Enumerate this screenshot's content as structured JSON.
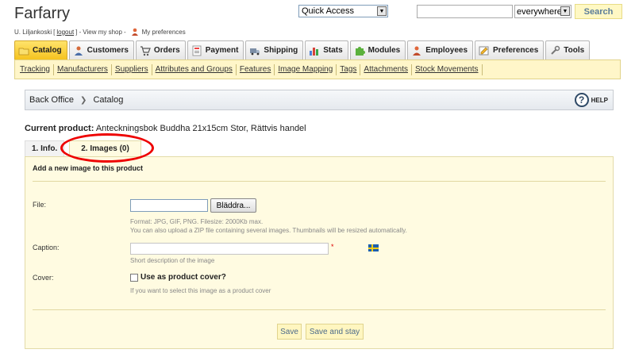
{
  "brand": "Farfarry",
  "user": {
    "name": "U. Liljankoski",
    "open_bracket": "[",
    "logout": "logout",
    "close_bracket": "] -",
    "view_shop": "View my shop",
    "dash": "-",
    "preferences": "My preferences"
  },
  "header": {
    "quick_access": "Quick Access",
    "search_value": "",
    "search_scope": "everywhere",
    "search_button": "Search"
  },
  "tabs": [
    {
      "label": "Catalog",
      "active": true,
      "icon": "folder-icon"
    },
    {
      "label": "Customers",
      "icon": "customers-icon"
    },
    {
      "label": "Orders",
      "icon": "cart-icon"
    },
    {
      "label": "Payment",
      "icon": "payment-icon"
    },
    {
      "label": "Shipping",
      "icon": "truck-icon"
    },
    {
      "label": "Stats",
      "icon": "stats-icon"
    },
    {
      "label": "Modules",
      "icon": "puzzle-icon"
    },
    {
      "label": "Employees",
      "icon": "employees-icon"
    },
    {
      "label": "Preferences",
      "icon": "preferences-icon"
    },
    {
      "label": "Tools",
      "icon": "tools-icon"
    }
  ],
  "subnav": [
    "Tracking",
    "Manufacturers",
    "Suppliers",
    "Attributes and Groups",
    "Features",
    "Image Mapping",
    "Tags",
    "Attachments",
    "Stock Movements"
  ],
  "breadcrumb": {
    "root": "Back Office",
    "sep": "❯",
    "current": "Catalog",
    "help": "HELP"
  },
  "product": {
    "label": "Current product:",
    "name": "Anteckningsbok Buddha 21x15cm Stor, Rättvis handel"
  },
  "product_tabs": [
    "1. Info.",
    "2. Images (0)"
  ],
  "form": {
    "title": "Add a new image to this product",
    "file_label": "File:",
    "browse_button": "Bläddra...",
    "file_hint_1": "Format: JPG, GIF, PNG. Filesize: 2000Kb max.",
    "file_hint_2": "You can also upload a ZIP file containing several images. Thumbnails will be resized automatically.",
    "caption_label": "Caption:",
    "required_marker": "*",
    "caption_hint": "Short description of the image",
    "cover_label": "Cover:",
    "cover_checkbox": "Use as product cover?",
    "cover_hint": "If you want to select this image as a product cover",
    "save": "Save",
    "save_stay": "Save and stay"
  }
}
